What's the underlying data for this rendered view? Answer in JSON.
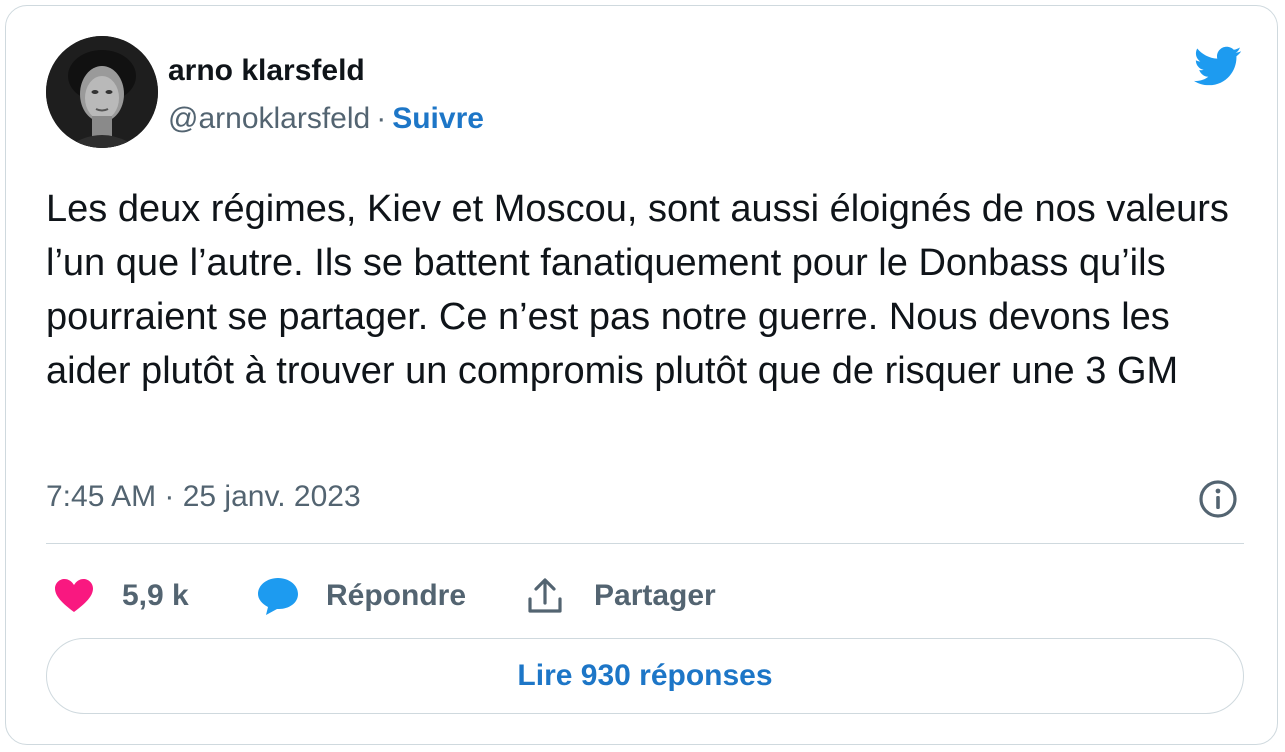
{
  "author": {
    "name": "arno klarsfeld",
    "handle": "@arnoklarsfeld",
    "separator": "·",
    "follow_label": "Suivre"
  },
  "tweet": {
    "text": "Les deux régimes, Kiev et Moscou, sont aussi éloignés de nos valeurs l’un que l’autre. Ils se battent fanatiquement pour le Donbass qu’ils pourraient se partager. Ce n’est pas notre guerre. Nous devons les aider plutôt à trouver un compromis plutôt que de risquer une 3 GM",
    "timestamp": "7:45 AM · 25 janv. 2023"
  },
  "actions": {
    "likes": "5,9 k",
    "reply_label": "Répondre",
    "share_label": "Partager"
  },
  "read_replies_label": "Lire 930 réponses",
  "icons": {
    "logo": "twitter-bird-icon",
    "info": "info-icon",
    "like": "heart-icon",
    "reply": "speech-bubble-icon",
    "share": "share-upload-icon"
  },
  "colors": {
    "twitter_blue": "#1d9bf0",
    "link_blue": "#1d76c7",
    "heart_pink": "#f91880",
    "text": "#0f1419",
    "muted": "#536471",
    "border": "#cfd9de"
  }
}
